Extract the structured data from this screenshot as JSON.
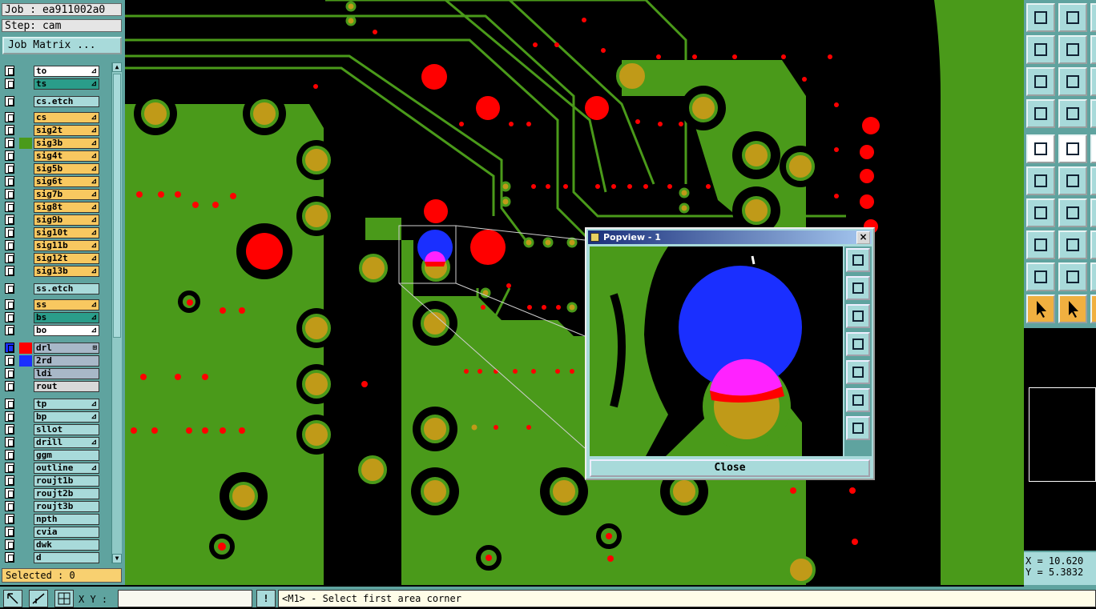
{
  "header": {
    "job": "Job : ea911002a0",
    "step": "Step: cam",
    "job_matrix": "Job Matrix ..."
  },
  "layers": [
    {
      "name": "to",
      "bg": "#ffffff",
      "mark": "⊿"
    },
    {
      "name": "ts",
      "bg": "#2a9d8a",
      "mark": "⊿"
    },
    {
      "name": "cs.etch",
      "bg": "#a8dada",
      "mark": ""
    },
    {
      "name": "cs",
      "bg": "#f8c860",
      "mark": "⊿"
    },
    {
      "name": "sig2t",
      "bg": "#f8c860",
      "mark": "⊿"
    },
    {
      "name": "sig3b",
      "bg": "#f8c860",
      "mark": "⊿"
    },
    {
      "name": "sig4t",
      "bg": "#f8c860",
      "mark": "⊿"
    },
    {
      "name": "sig5b",
      "bg": "#f8c860",
      "mark": "⊿"
    },
    {
      "name": "sig6t",
      "bg": "#f8c860",
      "mark": "⊿"
    },
    {
      "name": "sig7b",
      "bg": "#f8c860",
      "mark": "⊿"
    },
    {
      "name": "sig8t",
      "bg": "#f8c860",
      "mark": "⊿"
    },
    {
      "name": "sig9b",
      "bg": "#f8c860",
      "mark": "⊿"
    },
    {
      "name": "sig10t",
      "bg": "#f8c860",
      "mark": "⊿"
    },
    {
      "name": "sig11b",
      "bg": "#f8c860",
      "mark": "⊿"
    },
    {
      "name": "sig12t",
      "bg": "#f8c860",
      "mark": "⊿"
    },
    {
      "name": "sig13b",
      "bg": "#f8c860",
      "mark": "⊿"
    },
    {
      "name": "ss.etch",
      "bg": "#a8dada",
      "mark": ""
    },
    {
      "name": "ss",
      "bg": "#f8c860",
      "mark": "⊿"
    },
    {
      "name": "bs",
      "bg": "#2a9d8a",
      "mark": "⊿"
    },
    {
      "name": "bo",
      "bg": "#ffffff",
      "mark": "⊿"
    },
    {
      "name": "drl",
      "bg": "#a8b8c8",
      "mark": "⊞"
    },
    {
      "name": "2rd",
      "bg": "#a8b8c8",
      "mark": ""
    },
    {
      "name": "ldi",
      "bg": "#a8b8c8",
      "mark": ""
    },
    {
      "name": "rout",
      "bg": "#d8d8d8",
      "mark": ""
    },
    {
      "name": "tp",
      "bg": "#a8dada",
      "mark": "⊿"
    },
    {
      "name": "bp",
      "bg": "#a8dada",
      "mark": "⊿"
    },
    {
      "name": "sllot",
      "bg": "#a8dada",
      "mark": ""
    },
    {
      "name": "drill",
      "bg": "#a8dada",
      "mark": "⊿"
    },
    {
      "name": "ggm",
      "bg": "#a8dada",
      "mark": ""
    },
    {
      "name": "outline",
      "bg": "#a8dada",
      "mark": "⊿"
    },
    {
      "name": "roujt1b",
      "bg": "#a8dada",
      "mark": ""
    },
    {
      "name": "roujt2b",
      "bg": "#a8dada",
      "mark": ""
    },
    {
      "name": "roujt3b",
      "bg": "#a8dada",
      "mark": ""
    },
    {
      "name": "npth",
      "bg": "#a8dada",
      "mark": ""
    },
    {
      "name": "cvia",
      "bg": "#a8dada",
      "mark": ""
    },
    {
      "name": "dwk",
      "bg": "#a8dada",
      "mark": ""
    },
    {
      "name": "d",
      "bg": "#a8dada",
      "mark": ""
    }
  ],
  "selected": "Selected : 0",
  "coords": {
    "x": "X = 10.620",
    "y": "Y = 5.3832"
  },
  "bottom": {
    "xy_label": "X Y :",
    "xy_value": "",
    "warn": "!",
    "status": "<M1> - Select first area corner"
  },
  "popview": {
    "title": "Popview - 1",
    "close_x": "×",
    "close": "Close"
  },
  "colors": {
    "board": "#4a9a1a",
    "pad": "#c09a18",
    "drill": "#ff0000",
    "select": "#1a2fff",
    "overlap": "#ff22ff",
    "panel": "#a8dada"
  }
}
